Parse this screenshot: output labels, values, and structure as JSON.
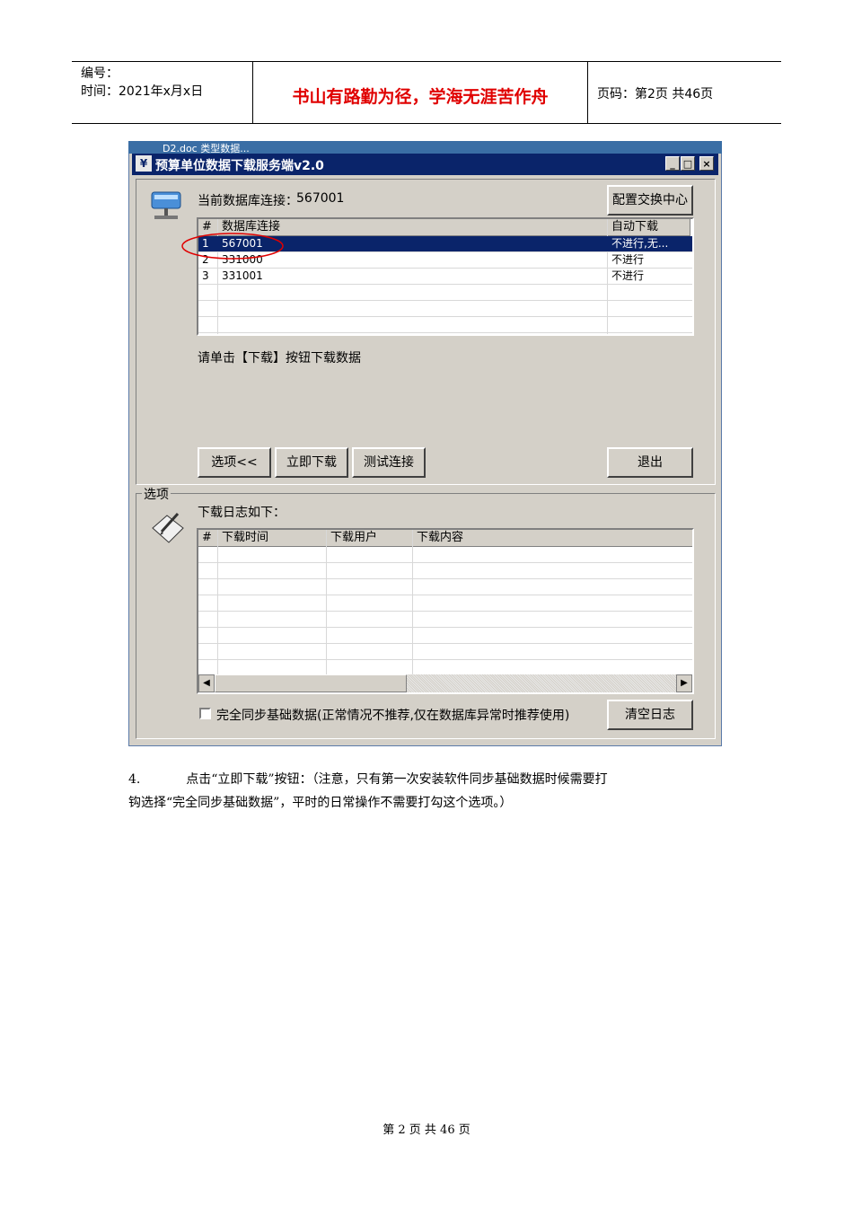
{
  "header": {
    "number_label": "编号：",
    "time_label": "时间：2021年x月x日",
    "motto": "书山有路勤为径，学海无涯苦作舟",
    "page_label": "页码：第2页  共46页"
  },
  "screenshot": {
    "desktop_text": "D2.doc          类型数据...",
    "window_title": "预算单位数据下载服务端v2.0",
    "title_buttons": {
      "minimize": "_",
      "maximize": "□",
      "close": "×"
    },
    "current_db_label": "当前数据库连接：",
    "current_db_value": "567001",
    "config_button": "配置交换中心",
    "db_table": {
      "headers": [
        "#",
        "数据库连接",
        "自动下载"
      ],
      "rows": [
        [
          "1",
          "567001",
          "不进行,无..."
        ],
        [
          "2",
          "331000",
          "不进行"
        ],
        [
          "3",
          "331001",
          "不进行"
        ]
      ]
    },
    "hint": "请单击【下载】按钮下载数据",
    "buttons": {
      "options": "选项<<",
      "download_now": "立即下载",
      "test_connection": "测试连接",
      "exit": "退出"
    },
    "options_group_label": "选项",
    "log_label": "下载日志如下：",
    "log_table": {
      "headers": [
        "#",
        "下载时间",
        "下载用户",
        "下载内容"
      ]
    },
    "full_sync_checkbox_label": "完全同步基础数据(正常情况不推荐,仅在数据库异常时推荐使用)",
    "full_sync_checked": false,
    "clear_log_button": "清空日志"
  },
  "step_number": "4.",
  "step_text_line1": "点击“立即下载”按钮：（注意，只有第一次安装软件同步基础数据时候需要打",
  "step_text_line2": "钩选择“完全同步基础数据”，平时的日常操作不需要打勾这个选项。）",
  "footer": "第 2 页 共 46 页",
  "colors": {
    "motto": "#e00000",
    "titlebar": "#0a246a",
    "selection": "#0a246a",
    "annotation_circle": "#e00000"
  }
}
